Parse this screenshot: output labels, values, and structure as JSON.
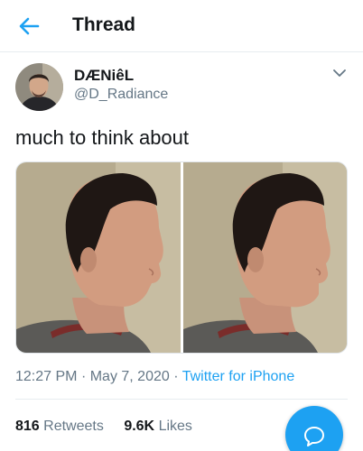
{
  "header": {
    "title": "Thread",
    "back_icon": "arrow-left-icon"
  },
  "tweet": {
    "display_name": "DÆNiêL",
    "handle": "@D_Radiance",
    "text": "much to think about",
    "time": "12:27 PM",
    "date": "May 7, 2020",
    "source": "Twitter for iPhone",
    "separator": "·"
  },
  "stats": {
    "retweets_count": "816",
    "retweets_label": "Retweets",
    "likes_count": "9.6K",
    "likes_label": "Likes"
  },
  "icons": {
    "caret": "chevron-down-icon",
    "compose": "reply-bubble-icon"
  },
  "colors": {
    "accent": "#1da1f2",
    "secondary_text": "#657786",
    "primary_text": "#14171a"
  }
}
